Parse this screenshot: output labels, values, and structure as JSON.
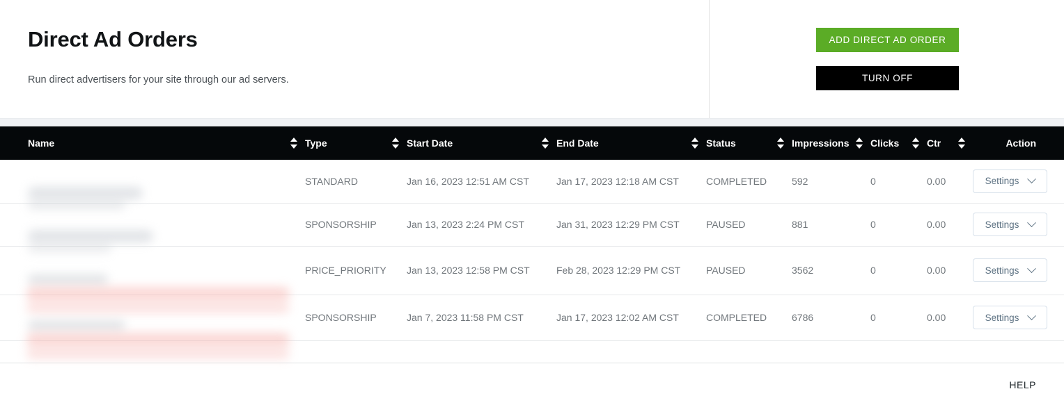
{
  "header": {
    "title": "Direct Ad Orders",
    "subtitle": "Run direct advertisers for your site through our ad servers.",
    "add_button": "ADD DIRECT AD ORDER",
    "turn_off_button": "TURN OFF",
    "add_button_color": "#5bac26",
    "turn_off_button_color": "#000000"
  },
  "table": {
    "columns": [
      {
        "key": "name",
        "label": "Name",
        "sortable": true,
        "align": "left"
      },
      {
        "key": "type",
        "label": "Type",
        "sortable": true,
        "align": "left"
      },
      {
        "key": "start_date",
        "label": "Start Date",
        "sortable": true,
        "align": "left"
      },
      {
        "key": "end_date",
        "label": "End Date",
        "sortable": true,
        "align": "left"
      },
      {
        "key": "status",
        "label": "Status",
        "sortable": true,
        "align": "left"
      },
      {
        "key": "impressions",
        "label": "Impressions",
        "sortable": true,
        "align": "left"
      },
      {
        "key": "clicks",
        "label": "Clicks",
        "sortable": true,
        "align": "left"
      },
      {
        "key": "ctr",
        "label": "Ctr",
        "sortable": true,
        "align": "left"
      },
      {
        "key": "action",
        "label": "Action",
        "sortable": false,
        "align": "right"
      }
    ],
    "header_bg": "#05080a",
    "rows": [
      {
        "name": "",
        "name_redacted": true,
        "type": "STANDARD",
        "start_date": "Jan 16, 2023 12:51 AM CST",
        "end_date": "Jan 17, 2023 12:18 AM CST",
        "status": "COMPLETED",
        "impressions": "592",
        "clicks": "0",
        "ctr": "0.00",
        "action_label": "Settings"
      },
      {
        "name": "",
        "name_redacted": true,
        "type": "SPONSORSHIP",
        "start_date": "Jan 13, 2023 2:24 PM CST",
        "end_date": "Jan 31, 2023 12:29 PM CST",
        "status": "PAUSED",
        "impressions": "881",
        "clicks": "0",
        "ctr": "0.00",
        "action_label": "Settings"
      },
      {
        "name": "",
        "name_redacted": true,
        "type": "PRICE_PRIORITY",
        "start_date": "Jan 13, 2023 12:58 PM CST",
        "end_date": "Feb 28, 2023 12:29 PM CST",
        "status": "PAUSED",
        "impressions": "3562",
        "clicks": "0",
        "ctr": "0.00",
        "action_label": "Settings"
      },
      {
        "name": "",
        "name_redacted": true,
        "type": "SPONSORSHIP",
        "start_date": "Jan 7, 2023 11:58 PM CST",
        "end_date": "Jan 17, 2023 12:02 AM CST",
        "status": "COMPLETED",
        "impressions": "6786",
        "clicks": "0",
        "ctr": "0.00",
        "action_label": "Settings"
      }
    ]
  },
  "footer": {
    "help_label": "HELP"
  }
}
